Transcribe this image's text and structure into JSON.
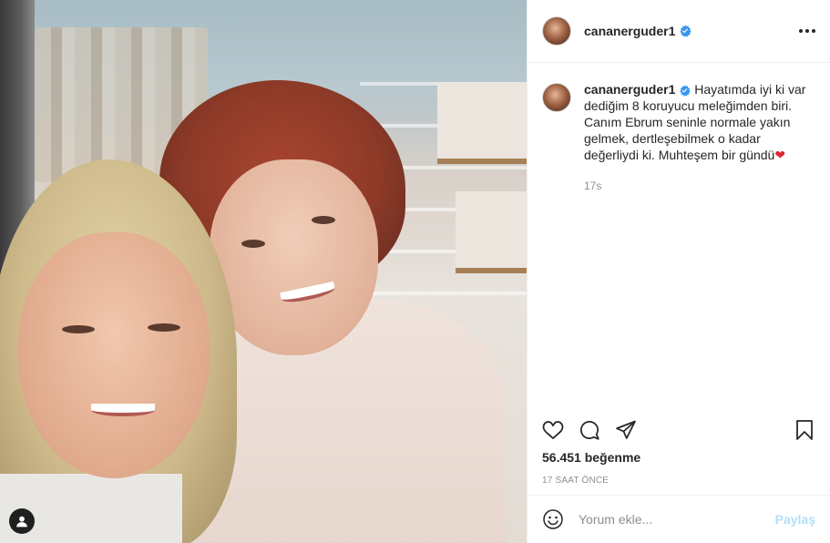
{
  "post": {
    "username": "cananerguder1",
    "verified": true,
    "caption": "Hayatımda iyi ki var dediğim 8 koruyucu meleğimden biri. Canım Ebrum seninle normale yakın gelmek, dertleşebilmek o kadar değerliydi ki. Muhteşem bir gündü",
    "caption_emoji": "❤",
    "caption_time": "17s",
    "likes_count": "56.451",
    "likes_label": "beğenme",
    "date": "17 SAAT ÖNCE"
  },
  "comment_box": {
    "placeholder": "Yorum ekle...",
    "share_label": "Paylaş"
  },
  "colors": {
    "verified": "#3897f0",
    "heart_emoji": "#e0242e",
    "share_disabled": "#b2dffc"
  },
  "icons": [
    "user-tag-icon",
    "verified-badge-icon",
    "more-options-icon",
    "heart-icon",
    "comment-icon",
    "share-icon",
    "bookmark-icon",
    "emoji-icon"
  ]
}
